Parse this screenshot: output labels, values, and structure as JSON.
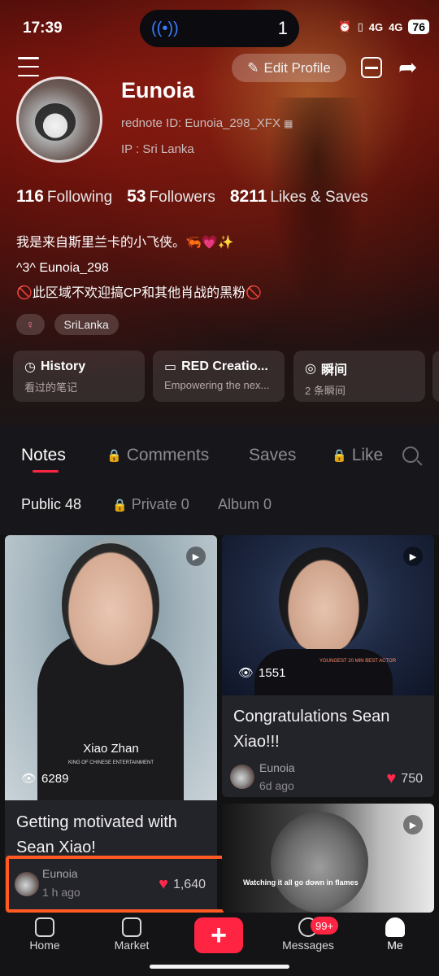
{
  "status_bar": {
    "time": "17:39",
    "island_number": "1",
    "signal1": "4G",
    "signal2": "4G",
    "battery": "76"
  },
  "profile": {
    "edit_label": "Edit Profile",
    "username": "Eunoia",
    "red_id": "rednote ID: Eunoia_298_XFX",
    "ip": "IP : Sri Lanka",
    "stats": [
      {
        "num": "116",
        "label": "Following"
      },
      {
        "num": "53",
        "label": "Followers"
      },
      {
        "num": "8211",
        "label": "Likes & Saves"
      }
    ],
    "bio": [
      "我是来自斯里兰卡的小飞侠。🦐💗✨",
      "^3^ Eunoia_298",
      "🚫此区域不欢迎搞CP和其他肖战的黑粉🚫"
    ],
    "tags": [
      "♀",
      "SriLanka"
    ]
  },
  "features": [
    {
      "title": "History",
      "sub": "看过的笔记",
      "icon": "history-icon"
    },
    {
      "title": "RED Creatio...",
      "sub": "Empowering the nex...",
      "icon": "creation-icon"
    },
    {
      "title": "瞬间",
      "sub": "2 条瞬间",
      "icon": "moment-icon"
    }
  ],
  "tabs": [
    "Notes",
    "Comments",
    "Saves",
    "Like"
  ],
  "subtabs": [
    "Public 48",
    "Private 0",
    "Album 0"
  ],
  "notes": [
    {
      "overlay_caption": "Xiao Zhan",
      "overlay_sub": "KING OF CHINESE ENTERTAINMENT",
      "views": "6289",
      "title": "Getting motivated with Sean Xiao!",
      "author": "Eunoia",
      "time": "1 h ago",
      "likes": "1,640"
    },
    {
      "overlay_caption": "YOUNGEST 20 MIN BEST ACTOR",
      "views": "1551",
      "title": "Congratulations Sean Xiao!!!",
      "author": "Eunoia",
      "time": "6d ago",
      "likes": "750"
    },
    {
      "overlay_caption": "Watching it all go down in flames"
    }
  ],
  "nav": {
    "home": "Home",
    "market": "Market",
    "messages": "Messages",
    "me": "Me",
    "badge": "99+"
  },
  "colors": {
    "accent": "#ff2442",
    "highlight": "#ff5b23"
  }
}
